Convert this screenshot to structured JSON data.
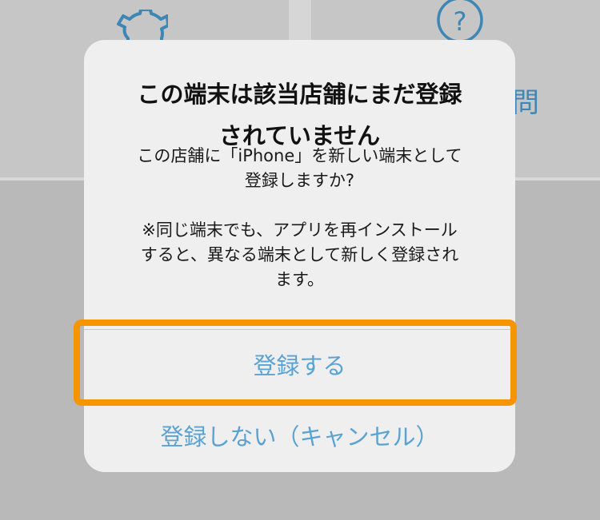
{
  "background": {
    "partial_label": "問",
    "icons": [
      "gear-icon",
      "help-icon"
    ]
  },
  "alert": {
    "title_line1": "この端末は該当店舗にまだ登録",
    "title_line2": "されていません",
    "message": "この店舗に「iPhone」を新しい端末として\n登録しますか?\n\n※同じ端末でも、アプリを再インストール\nすると、異なる端末として新しく登録され\nます。",
    "register_label": "登録する",
    "cancel_label": "登録しない（キャンセル）"
  },
  "colors": {
    "button_text": "#5aa2d2",
    "highlight": "#f79500",
    "background_accent": "#3e86b4"
  }
}
